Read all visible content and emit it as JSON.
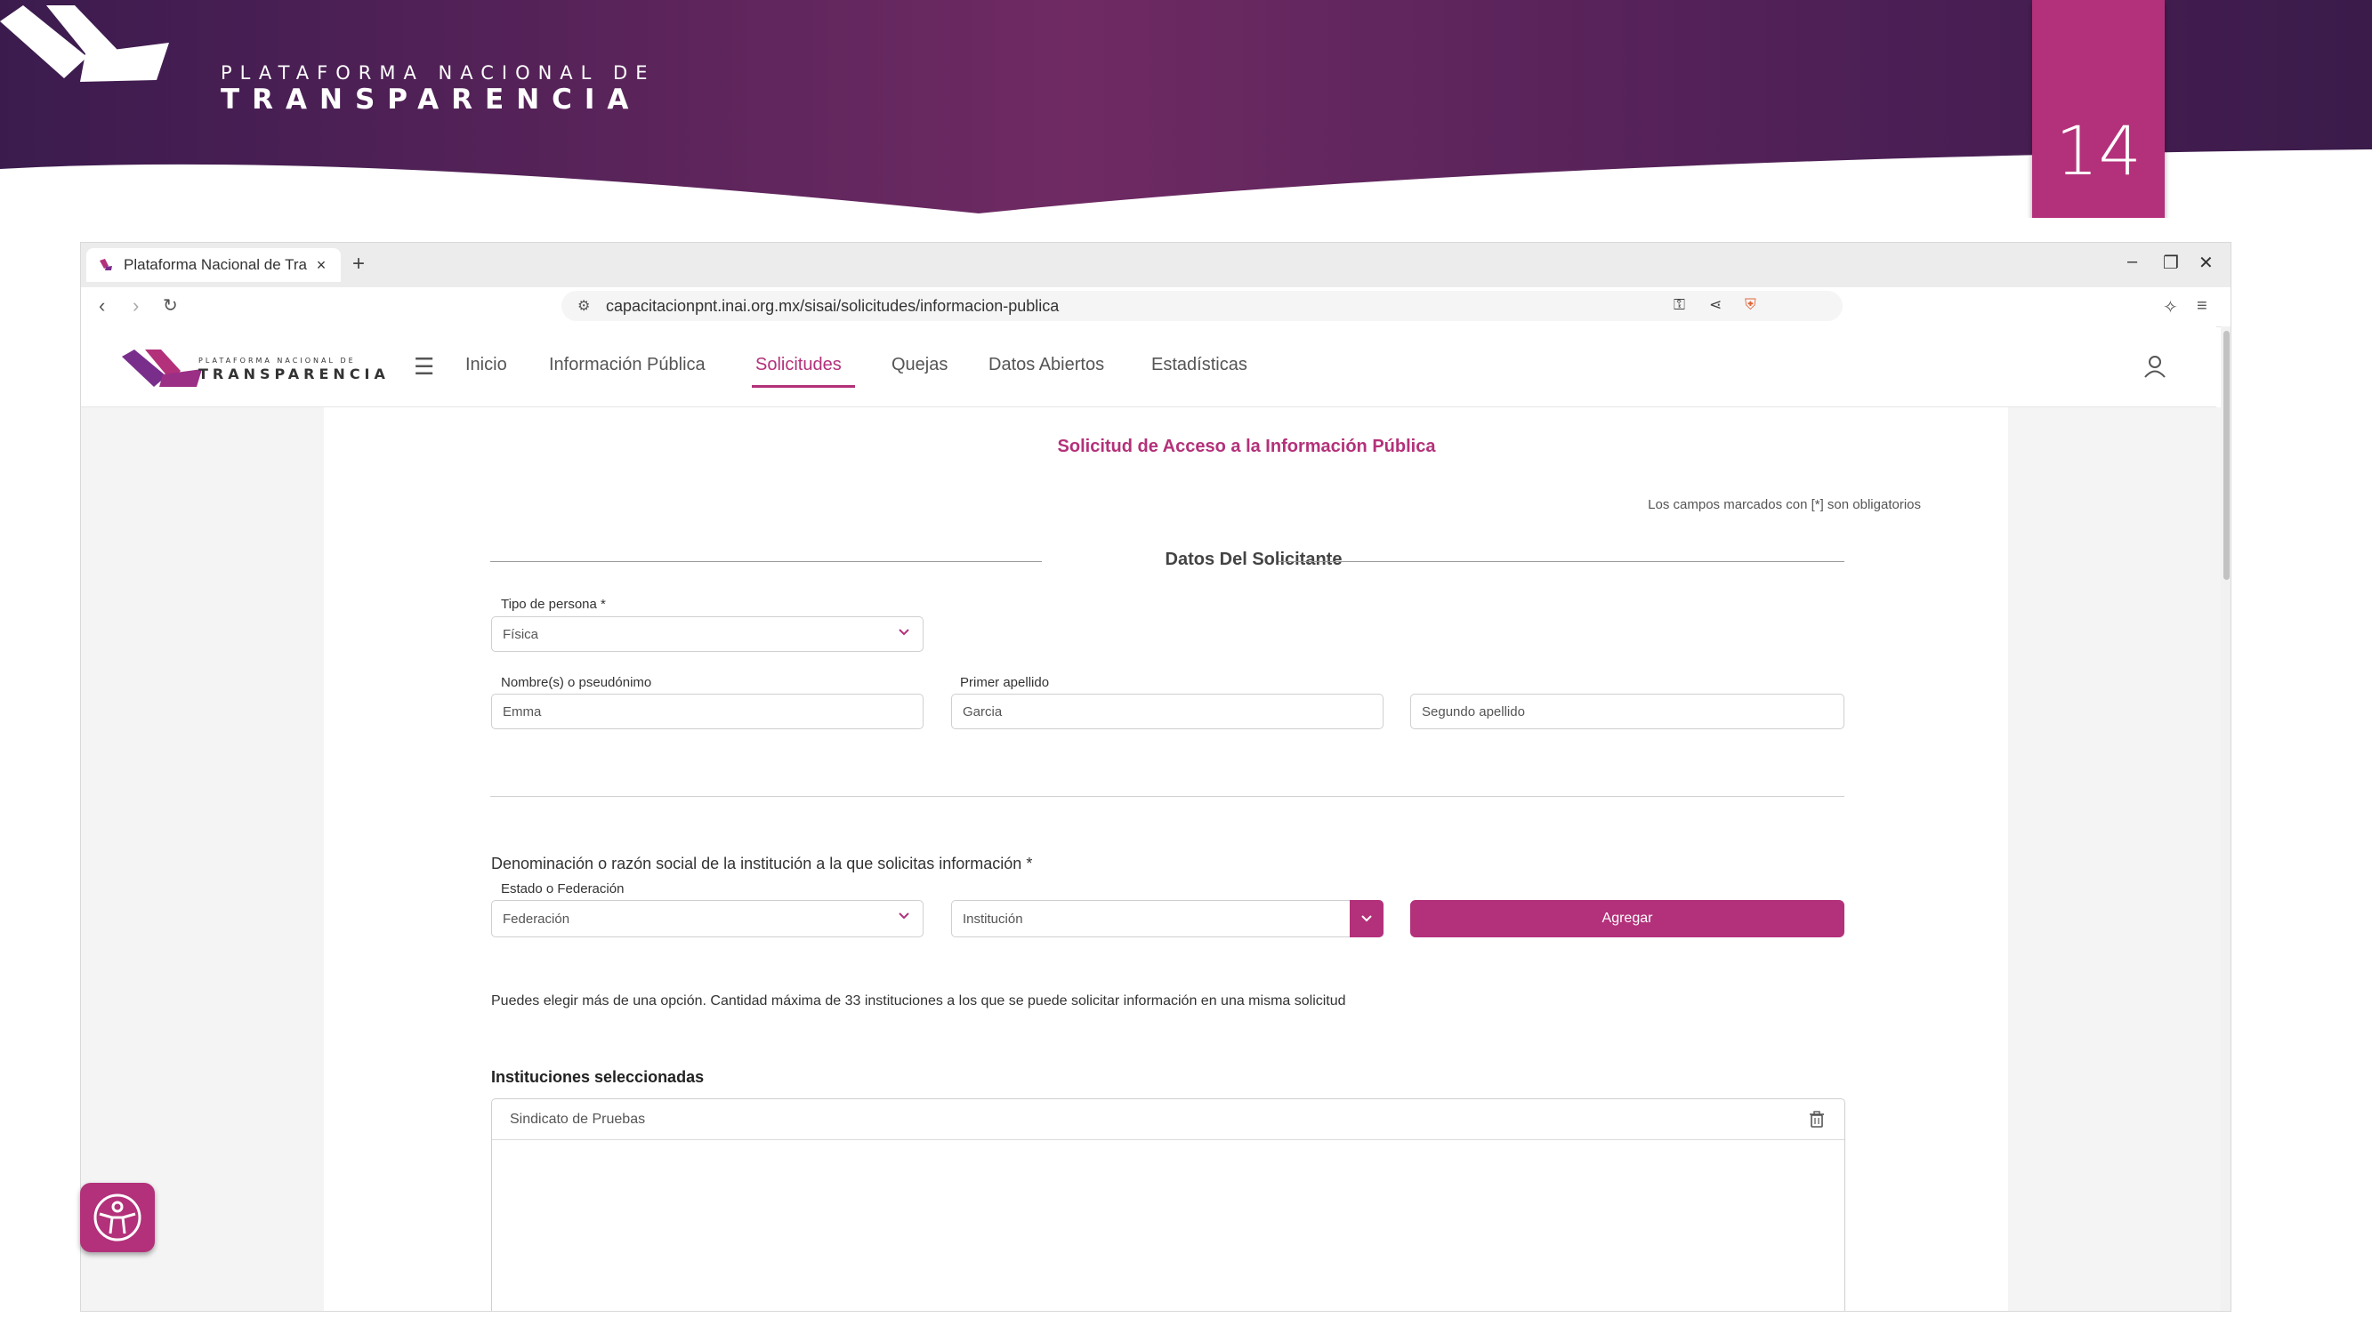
{
  "slide": {
    "brand_line1": "PLATAFORMA NACIONAL DE",
    "brand_line2": "TRANSPARENCIA",
    "slide_number": "14",
    "accent": "#b3317a"
  },
  "browser": {
    "tab_title": "Plataforma Nacional de Tra",
    "tab_close": "×",
    "new_tab": "+",
    "url": "capacitacionpnt.inai.org.mx/sisai/solicitudes/informacion-publica"
  },
  "site": {
    "brand_line1": "PLATAFORMA NACIONAL DE",
    "brand_line2": "TRANSPARENCIA",
    "nav": [
      "Inicio",
      "Información Pública",
      "Solicitudes",
      "Quejas",
      "Datos Abiertos",
      "Estadísticas"
    ],
    "active_nav": "Solicitudes"
  },
  "form": {
    "title": "Solicitud de Acceso a la Información Pública",
    "required_note": "Los campos marcados con [*] son obligatorios",
    "section_title": "Datos Del Solicitante",
    "tipo_persona_label": "Tipo de persona *",
    "tipo_persona_value": "Física",
    "nombre_label": "Nombre(s) o pseudónimo",
    "nombre_value": "Emma",
    "apellido1_label": "Primer apellido",
    "apellido1_value": "Garcia",
    "apellido2_placeholder": "Segundo apellido",
    "institucion_question": "Denominación o razón social de la institución a la que solicitas información *",
    "estado_label": "Estado o Federación",
    "estado_value": "Federación",
    "institucion_placeholder": "Institución",
    "agregar_label": "Agregar",
    "help_text": "Puedes elegir más de una opción. Cantidad máxima de 33 instituciones a los que se puede solicitar información en una misma solicitud",
    "selected_title": "Instituciones seleccionadas",
    "selected_items": [
      "Sindicato de Pruebas"
    ]
  }
}
